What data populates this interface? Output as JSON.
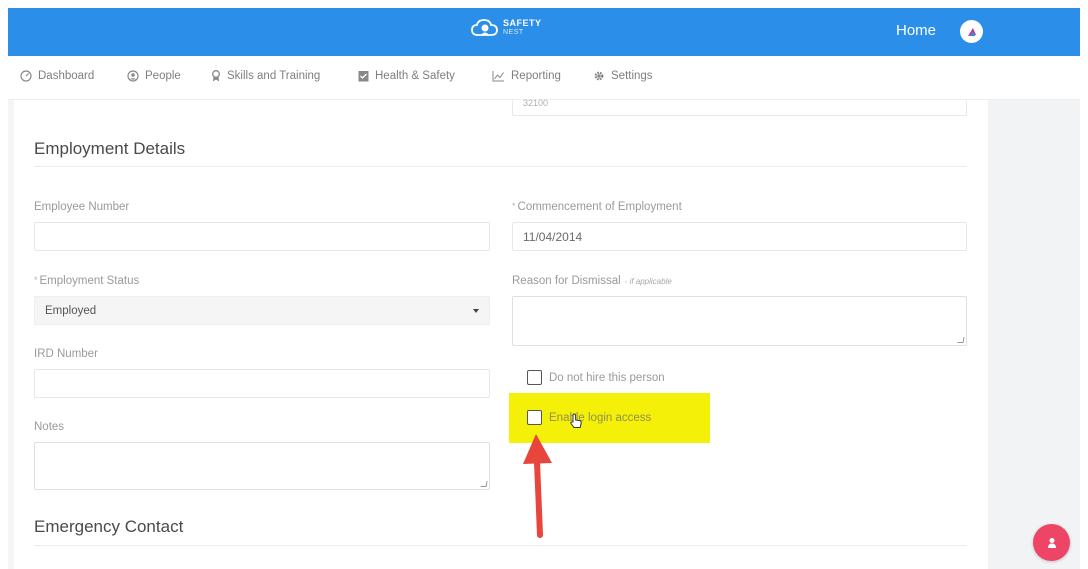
{
  "header": {
    "logo_main": "SAFETY",
    "logo_sub": "NEST",
    "home_label": "Home"
  },
  "nav": {
    "items": [
      {
        "label": "Dashboard",
        "icon": "dashboard-icon"
      },
      {
        "label": "People",
        "icon": "person-icon"
      },
      {
        "label": "Skills and Training",
        "icon": "ribbon-icon"
      },
      {
        "label": "Health & Safety",
        "icon": "clipboard-icon"
      },
      {
        "label": "Reporting",
        "icon": "chart-icon"
      },
      {
        "label": "Settings",
        "icon": "gear-icon"
      }
    ]
  },
  "form": {
    "top_partial_value": "32100",
    "employment_title": "Employment Details",
    "employee_number_label": "Employee Number",
    "employee_number_value": "",
    "commencement_label": "Commencement of Employment",
    "commencement_value": "11/04/2014",
    "status_label": "Employment Status",
    "status_value": "Employed",
    "dismissal_label": "Reason for Dismissal",
    "dismissal_sub": "- if applicable",
    "ird_label": "IRD Number",
    "ird_value": "",
    "notes_label": "Notes",
    "do_not_hire_label": "Do not hire this person",
    "enable_login_label": "Enable login access",
    "emergency_title": "Emergency Contact",
    "required_mark": "*"
  },
  "fab": {
    "icon": "user-icon"
  },
  "colors": {
    "header": "#2b8ee8",
    "highlight": "#f5f008",
    "arrow": "#e8453c",
    "fab": "#ee4466"
  }
}
